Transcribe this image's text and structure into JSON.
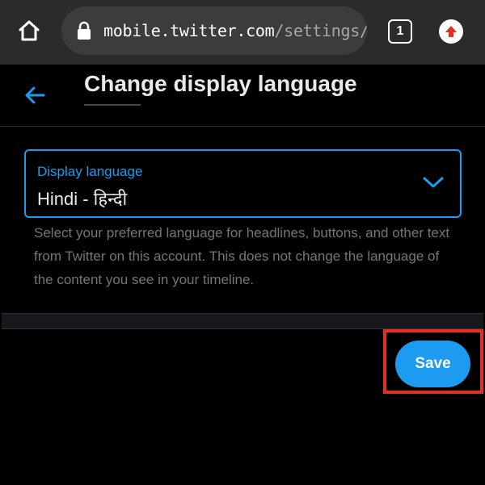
{
  "browser": {
    "url_host": "mobile.twitter.com",
    "url_path": "/settings/lar",
    "tab_count": "1"
  },
  "header": {
    "title": "Change display language"
  },
  "language_select": {
    "label": "Display language",
    "value": "Hindi - हिन्दी"
  },
  "help_text": "Select your preferred language for headlines, buttons, and other text from Twitter on this account. This does not change the language of the content you see in your timeline.",
  "actions": {
    "save_label": "Save"
  },
  "colors": {
    "accent": "#1d9bf0",
    "highlight": "#e0301e",
    "background": "#000000",
    "browser_bar": "#2b2b2d"
  }
}
